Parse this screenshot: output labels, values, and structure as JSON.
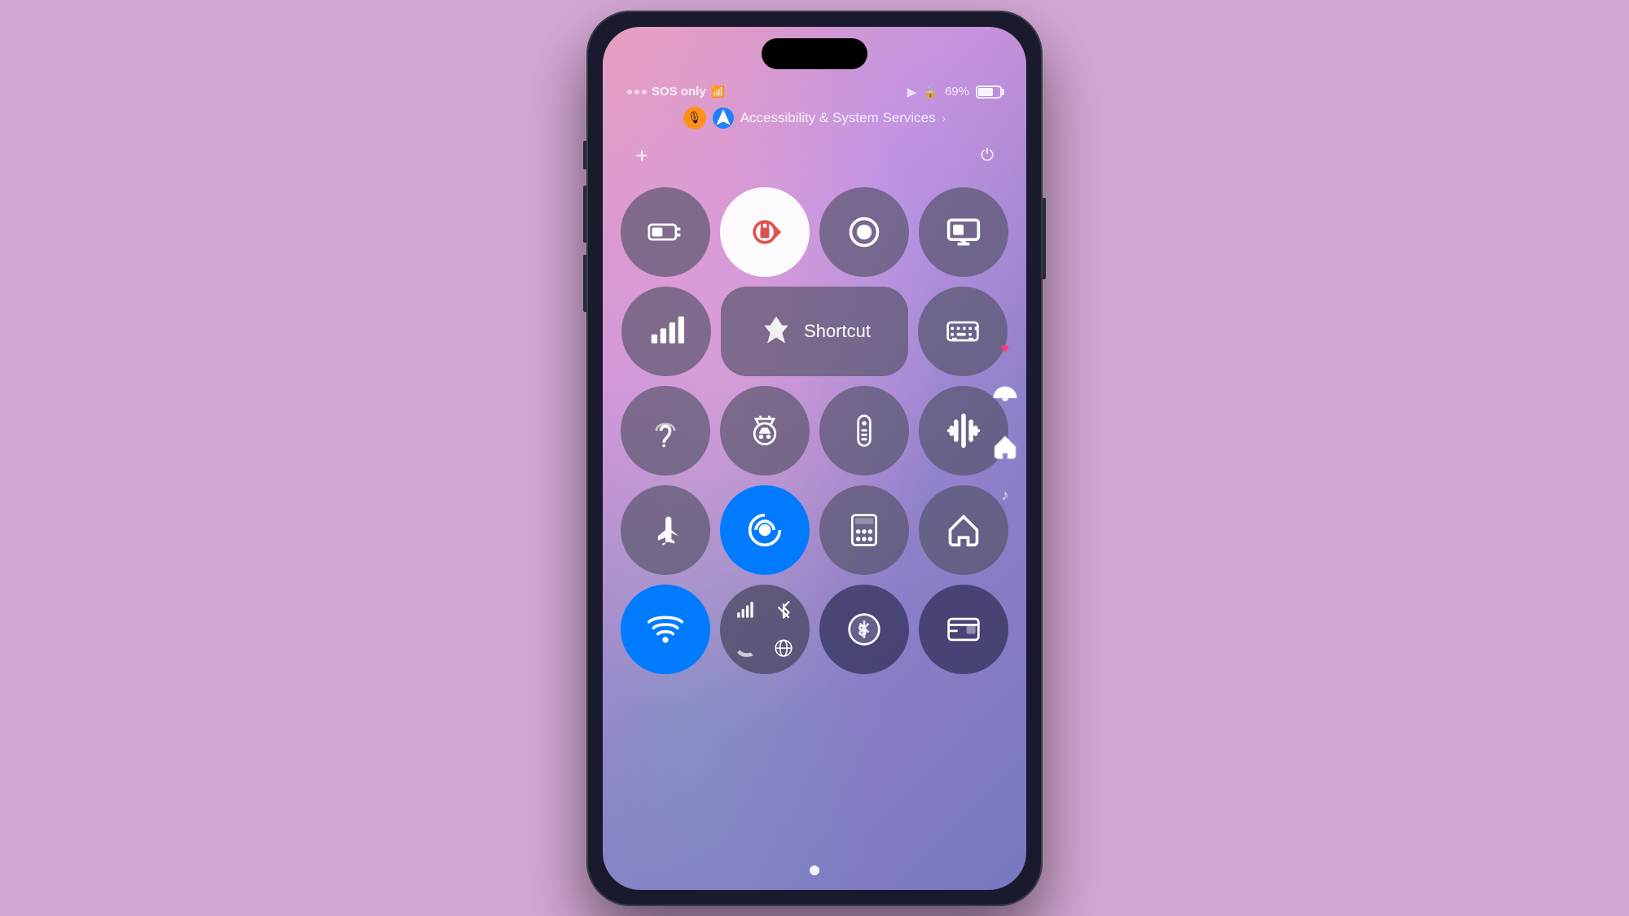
{
  "phone": {
    "dynamicIsland": true,
    "statusBar": {
      "carrier": "SOS only",
      "wifi": true,
      "location": true,
      "lockRotation": true,
      "battery": "69%",
      "batteryLevel": 69
    },
    "accessibilityHeader": {
      "title": "Accessibility & System Services",
      "micIcon": "🎙",
      "locationIcon": "◀"
    },
    "topBar": {
      "plusLabel": "+",
      "powerLabel": "⏻"
    },
    "rows": [
      {
        "id": "row1",
        "items": [
          {
            "id": "low-power",
            "icon": "battery",
            "active": false
          },
          {
            "id": "rotate-lock",
            "icon": "rotate-lock",
            "active": true
          },
          {
            "id": "screen-record",
            "icon": "record",
            "active": false
          },
          {
            "id": "screen-mirror",
            "icon": "mirror",
            "active": false
          }
        ]
      },
      {
        "id": "row2",
        "items": [
          {
            "id": "cellular",
            "icon": "signal",
            "active": false
          },
          {
            "id": "shortcut",
            "icon": "shortcut",
            "label": "Shortcut",
            "wide": true
          },
          {
            "id": "keyboard",
            "icon": "keyboard",
            "active": false
          }
        ]
      },
      {
        "id": "row3",
        "items": [
          {
            "id": "hearing",
            "icon": "hearing",
            "active": false
          },
          {
            "id": "driving",
            "icon": "driving",
            "active": false
          },
          {
            "id": "remote",
            "icon": "remote",
            "active": false
          },
          {
            "id": "sound",
            "icon": "sound",
            "active": false
          }
        ]
      },
      {
        "id": "row4",
        "items": [
          {
            "id": "airplane",
            "icon": "airplane",
            "active": false
          },
          {
            "id": "airdrop",
            "icon": "airdrop",
            "active": true,
            "blue": true
          },
          {
            "id": "calculator",
            "icon": "calculator",
            "active": false
          },
          {
            "id": "home",
            "icon": "home",
            "active": false
          }
        ]
      },
      {
        "id": "row5",
        "items": [
          {
            "id": "wifi",
            "icon": "wifi",
            "active": true,
            "blue": true
          },
          {
            "id": "network-cluster",
            "icon": "cluster"
          },
          {
            "id": "cash",
            "icon": "cash"
          },
          {
            "id": "wallet",
            "icon": "wallet"
          }
        ]
      }
    ],
    "rightSideIcons": [
      {
        "id": "heart",
        "icon": "♥",
        "type": "heart"
      },
      {
        "id": "broadcast",
        "icon": "((·))"
      },
      {
        "id": "home-small",
        "icon": "⌂"
      },
      {
        "id": "music",
        "icon": "♪"
      }
    ],
    "bottomDot": true
  }
}
